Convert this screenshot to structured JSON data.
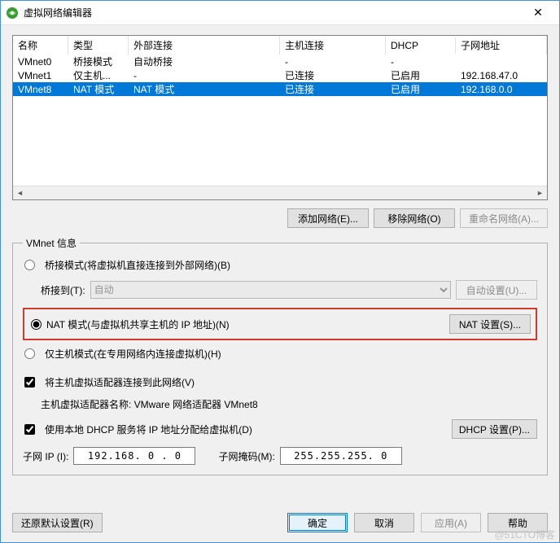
{
  "window": {
    "title": "虚拟网络编辑器",
    "close_glyph": "✕"
  },
  "table": {
    "headers": [
      "名称",
      "类型",
      "外部连接",
      "主机连接",
      "DHCP",
      "子网地址"
    ],
    "rows": [
      {
        "cells": [
          "VMnet0",
          "桥接模式",
          "自动桥接",
          "-",
          "-",
          ""
        ],
        "selected": false
      },
      {
        "cells": [
          "VMnet1",
          "仅主机...",
          "-",
          "已连接",
          "已启用",
          "192.168.47.0"
        ],
        "selected": false
      },
      {
        "cells": [
          "VMnet8",
          "NAT 模式",
          "NAT 模式",
          "已连接",
          "已启用",
          "192.168.0.0"
        ],
        "selected": true
      }
    ],
    "scroll": {
      "left_arrow": "◄",
      "right_arrow": "►"
    }
  },
  "actions": {
    "add": "添加网络(E)...",
    "remove": "移除网络(O)",
    "rename": "重命名网络(A)..."
  },
  "group": {
    "legend": "VMnet 信息",
    "bridge_label": "桥接模式(将虚拟机直接连接到外部网络)(B)",
    "bridge_to_label": "桥接到(T):",
    "bridge_to_value": "自动",
    "auto_settings": "自动设置(U)...",
    "nat_label": "NAT 模式(与虚拟机共享主机的 IP 地址)(N)",
    "nat_settings": "NAT 设置(S)...",
    "host_only_label": "仅主机模式(在专用网络内连接虚拟机)(H)",
    "connect_host_label": "将主机虚拟适配器连接到此网络(V)",
    "host_adapter_text": "主机虚拟适配器名称: VMware 网络适配器 VMnet8",
    "dhcp_label": "使用本地 DHCP 服务将 IP 地址分配给虚拟机(D)",
    "dhcp_settings": "DHCP 设置(P)...",
    "subnet_ip_label": "子网 IP (I):",
    "subnet_ip_value": "192.168.  0 .  0",
    "subnet_mask_label": "子网掩码(M):",
    "subnet_mask_value": "255.255.255.  0"
  },
  "footer": {
    "restore": "还原默认设置(R)",
    "ok": "确定",
    "cancel": "取消",
    "apply": "应用(A)",
    "help": "帮助"
  },
  "watermark": "@51CTO博客"
}
